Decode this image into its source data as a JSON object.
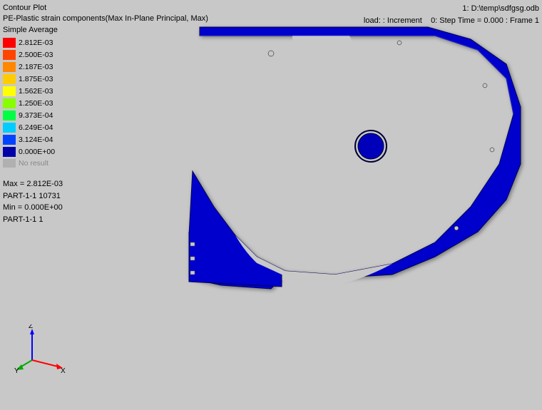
{
  "title": "Contour Plot",
  "subtitle": "PE-Plastic strain components(Max In-Plane Principal, Max)",
  "averaging": "Simple Average",
  "top_right": {
    "file": "1: D:\\temp\\sdfgsg.odb",
    "load_label": "load: : Increment",
    "step": "0: Step Time =  0.000 : Frame 1"
  },
  "legend": {
    "items": [
      {
        "value": "2.812E-03",
        "color": "#FF0000"
      },
      {
        "value": "2.500E-03",
        "color": "#FF4400"
      },
      {
        "value": "2.187E-03",
        "color": "#FF8800"
      },
      {
        "value": "1.875E-03",
        "color": "#FFCC00"
      },
      {
        "value": "1.562E-03",
        "color": "#FFFF00"
      },
      {
        "value": "1.250E-03",
        "color": "#88FF00"
      },
      {
        "value": "9.373E-04",
        "color": "#00FF44"
      },
      {
        "value": "6.249E-04",
        "color": "#00CCFF"
      },
      {
        "value": "3.124E-04",
        "color": "#0044FF"
      },
      {
        "value": "0.000E+00",
        "color": "#0000AA"
      }
    ],
    "no_result_label": "No result"
  },
  "stats": {
    "max_label": "Max = 2.812E-03",
    "max_part": "PART-1-1 10731",
    "min_label": "Min = 0.000E+00",
    "min_part": "PART-1-1 1"
  },
  "axes": {
    "z_label": "Z",
    "y_label": "Y",
    "x_label": "X"
  }
}
